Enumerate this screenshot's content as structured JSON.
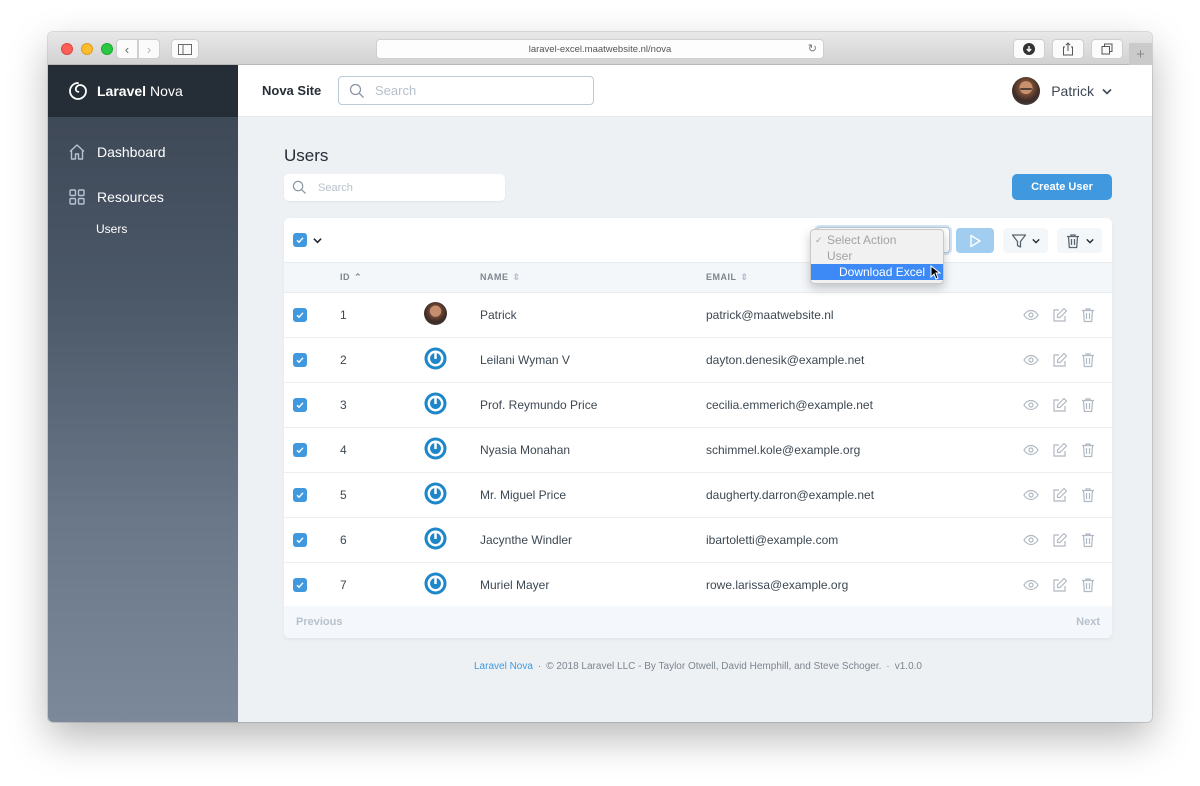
{
  "browser": {
    "url": "laravel-excel.maatwebsite.nl/nova",
    "new_tab_label": "+"
  },
  "brand": {
    "bold": "Laravel",
    "light": "Nova"
  },
  "sidebar": {
    "items": [
      {
        "label": "Dashboard",
        "icon": "home-icon"
      },
      {
        "label": "Resources",
        "icon": "grid-icon"
      }
    ],
    "sub_items": [
      {
        "label": "Users"
      }
    ]
  },
  "topbar": {
    "site_name": "Nova Site",
    "search_placeholder": "Search",
    "user_name": "Patrick"
  },
  "page": {
    "title": "Users",
    "search_placeholder": "Search",
    "create_button": "Create User"
  },
  "actions": {
    "select_placeholder": "Select Action",
    "dropdown_options": [
      {
        "label": "Select Action",
        "state": "checked"
      },
      {
        "label": "User",
        "state": "group-label"
      },
      {
        "label": "Download Excel",
        "state": "highlighted"
      }
    ]
  },
  "table": {
    "columns": [
      "ID",
      "NAME",
      "EMAIL"
    ],
    "rows": [
      {
        "id": "1",
        "name": "Patrick",
        "email": "patrick@maatwebsite.nl",
        "avatar": "photo",
        "selected": true
      },
      {
        "id": "2",
        "name": "Leilani Wyman V",
        "email": "dayton.denesik@example.net",
        "avatar": "gravatar",
        "selected": true
      },
      {
        "id": "3",
        "name": "Prof. Reymundo Price",
        "email": "cecilia.emmerich@example.net",
        "avatar": "gravatar",
        "selected": true
      },
      {
        "id": "4",
        "name": "Nyasia Monahan",
        "email": "schimmel.kole@example.org",
        "avatar": "gravatar",
        "selected": true
      },
      {
        "id": "5",
        "name": "Mr. Miguel Price",
        "email": "daugherty.darron@example.net",
        "avatar": "gravatar",
        "selected": true
      },
      {
        "id": "6",
        "name": "Jacynthe Windler",
        "email": "ibartoletti@example.com",
        "avatar": "gravatar",
        "selected": true
      },
      {
        "id": "7",
        "name": "Muriel Mayer",
        "email": "rowe.larissa@example.org",
        "avatar": "gravatar",
        "selected": true
      }
    ],
    "select_all": true
  },
  "pagination": {
    "previous": "Previous",
    "next": "Next"
  },
  "footer": {
    "link": "Laravel Nova",
    "separator": "·",
    "copyright": "© 2018 Laravel LLC - By Taylor Otwell, David Hemphill, and Steve Schoger.",
    "version": "v1.0.0"
  },
  "colors": {
    "primary": "#4099de",
    "sidebar_dark": "#252d37",
    "highlight": "#3d8af7"
  }
}
